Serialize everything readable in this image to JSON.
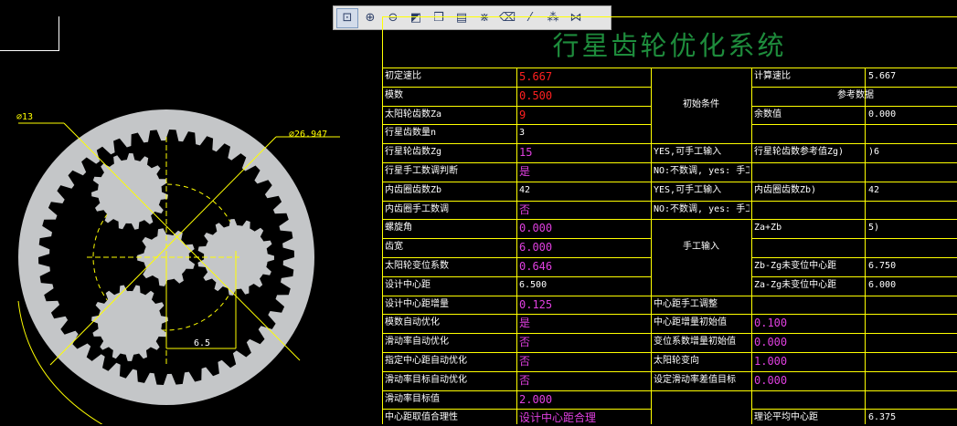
{
  "app_title": "行星齿轮优化系统",
  "toolbar": {
    "icons": [
      "zoom-fit-icon",
      "zoom-in-icon",
      "zoom-out-icon",
      "shade-icon",
      "cube-view-icon",
      "layer-icon",
      "dim-icon",
      "erase-icon",
      "param-icon",
      "grid-icon",
      "regen-icon"
    ]
  },
  "drawing": {
    "dim_small": "∅13",
    "dim_large": "∅26.947",
    "dim_center": "6.5"
  },
  "table": {
    "rows": [
      {
        "label": "初定速比",
        "value": "5.667"
      },
      {
        "label": "模数",
        "value": "0.500"
      },
      {
        "label": "太阳轮齿数Za",
        "value": "9"
      },
      {
        "label": "行星齿数量n",
        "value": "3"
      },
      {
        "label": "行星轮齿数Zg",
        "value": "15",
        "note": "YES,可手工输入"
      },
      {
        "label": "行星手工数调判断",
        "value": "是",
        "note": "NO:不数调, yes: 手工"
      },
      {
        "label": "内齿圈齿数Zb",
        "value": "42",
        "note": "YES,可手工输入"
      },
      {
        "label": "内齿圈手工数调",
        "value": "否",
        "note": "NO:不数调, yes: 手工"
      },
      {
        "label": "螺旋角",
        "value": "0.000"
      },
      {
        "label": "齿宽",
        "value": "6.000"
      },
      {
        "label": "太阳轮变位系数",
        "value": "0.646"
      },
      {
        "label": "设计中心距",
        "value": "6.500"
      },
      {
        "label": "设计中心距增量",
        "value": "0.125",
        "note": "中心距手工调整"
      },
      {
        "label": "模数自动优化",
        "value": "是",
        "note": "中心距增量初始值",
        "extra": "0.100"
      },
      {
        "label": "滑动率自动优化",
        "value": "否",
        "note": "变位系数增量初始值",
        "extra": "0.000"
      },
      {
        "label": "指定中心距自动优化",
        "value": "否",
        "note": "太阳轮变向",
        "extra": "1.000"
      },
      {
        "label": "滑动率目标自动优化",
        "value": "否",
        "note": "设定滑动率差值目标",
        "extra": "0.000"
      },
      {
        "label": "滑动率目标值",
        "value": "2.000"
      },
      {
        "label": "中心距取值合理性",
        "value": "设计中心距合理"
      }
    ],
    "mid_sections": [
      "初始条件",
      "手工输入"
    ],
    "right_header": "参考数据",
    "right_rows": [
      {
        "label": "计算速比",
        "value": "5.667"
      },
      {
        "label": "余数值",
        "value": "0.000"
      },
      {
        "label": "行星轮齿数参考值Zg)",
        "value": ")6"
      },
      {
        "label": "内齿圈齿数Zb)",
        "value": "42"
      },
      {
        "label": "Za+Zb",
        "value": "5)"
      },
      {
        "label": "Zb-Zg未变位中心距",
        "value": "6.750"
      },
      {
        "label": "Za-Zg未变位中心距",
        "value": "6.000"
      },
      {
        "label": "理论平均中心距",
        "value": "6.375"
      }
    ]
  },
  "colors": {
    "grid": "#ffff00",
    "title": "#1e8c3c",
    "red_value": "#ff2020",
    "magenta_value": "#e040e0",
    "gear_fill": "#c4c6c8",
    "dim_line": "#ffff00"
  }
}
